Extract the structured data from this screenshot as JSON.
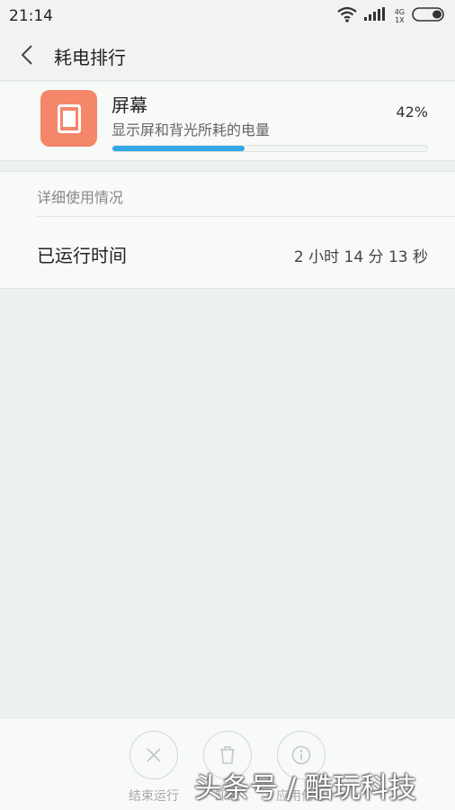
{
  "status_bar": {
    "time": "21:14",
    "network_type": "4G",
    "network_sub": "1X",
    "icons": [
      "wifi-icon",
      "signal-icon",
      "battery-icon"
    ]
  },
  "header": {
    "title": "耗电排行",
    "back_icon": "chevron-left-icon"
  },
  "app_item": {
    "name": "屏幕",
    "description": "显示屏和背光所耗的电量",
    "percent_text": "42%",
    "usage_fraction": 0.42,
    "icon": "screen-icon",
    "icon_color": "#f4876a",
    "progress_color": "#33a8e7"
  },
  "details": {
    "section_label": "详细使用情况",
    "runtime_label": "已运行时间",
    "runtime_value": "2 小时 14 分 13 秒"
  },
  "bottom_actions": [
    {
      "label": "结束运行",
      "icon": "close-icon"
    },
    {
      "label": "卸载",
      "icon": "trash-icon"
    },
    {
      "label": "应用信息",
      "icon": "info-icon"
    }
  ],
  "watermark": "头条号 / 酷玩科技"
}
